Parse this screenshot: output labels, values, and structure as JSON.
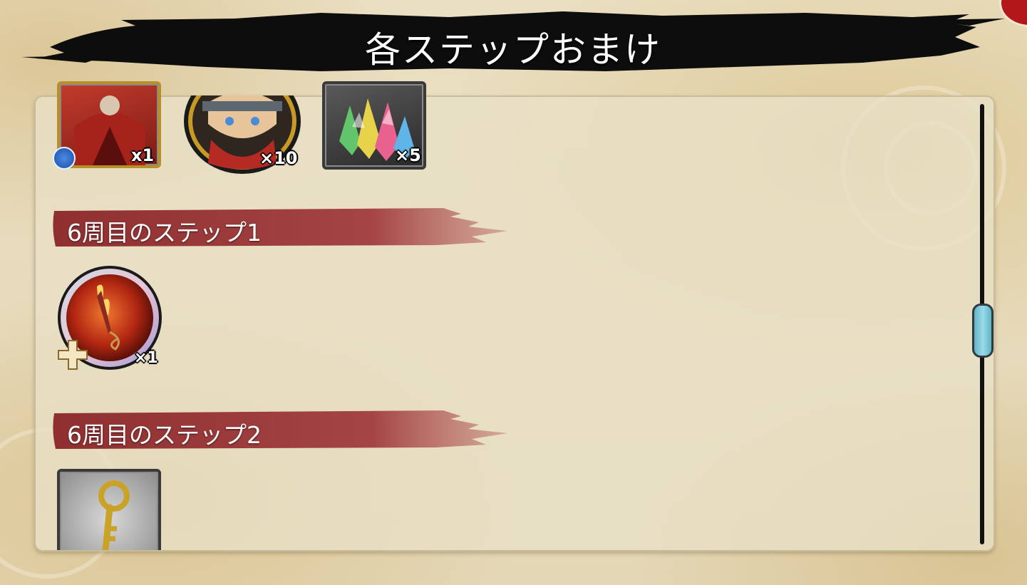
{
  "title": "各ステップおまけ",
  "sections": [
    {
      "label": "6周目のステップ1"
    },
    {
      "label": "6周目のステップ2"
    }
  ],
  "top_rewards": [
    {
      "icon": "character-card-red-cloak",
      "qty": "x1"
    },
    {
      "icon": "naruto-portrait-medal",
      "qty": "×10"
    },
    {
      "icon": "rainbow-crystal",
      "qty": "×5"
    }
  ],
  "step1_rewards": [
    {
      "icon": "flame-kunai-equipment",
      "qty": "×1"
    }
  ],
  "step2_rewards": [
    {
      "icon": "golden-key",
      "qty": ""
    }
  ],
  "colors": {
    "banner": "#0d0d0d",
    "section_red": "#9c3a3a",
    "scroll_thumb": "#7ec8d8",
    "parchment": "#e7dcbd"
  }
}
